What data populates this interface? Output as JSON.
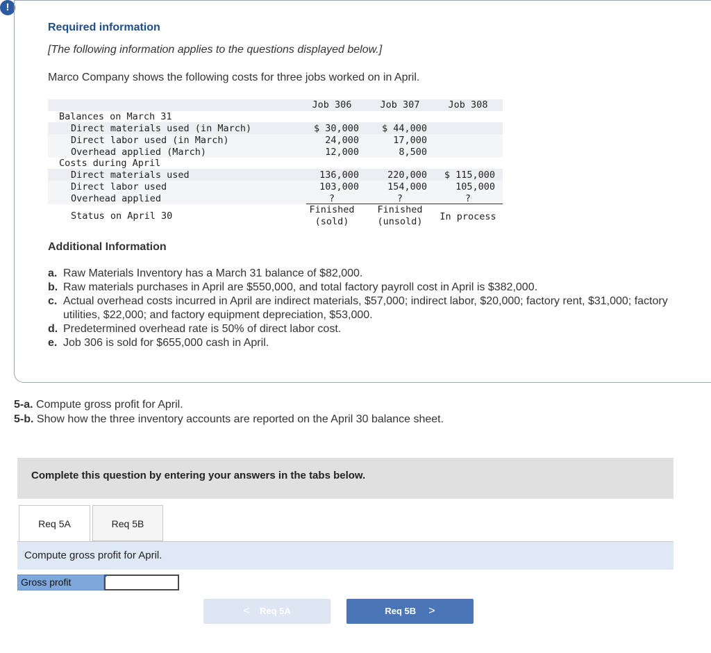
{
  "header": {
    "alert_glyph": "!",
    "title": "Required information",
    "subtitle": "[The following information applies to the questions displayed below.]",
    "intro": "Marco Company shows the following costs for three jobs worked on in April."
  },
  "cost_table": {
    "columns": [
      "Job 306",
      "Job 307",
      "Job 308"
    ],
    "section1": "Balances on March 31",
    "rows1": [
      {
        "label": "Direct materials used (in March)",
        "values": [
          "$ 30,000",
          "$ 44,000",
          ""
        ]
      },
      {
        "label": "Direct labor used (in March)",
        "values": [
          "24,000",
          "17,000",
          ""
        ]
      },
      {
        "label": "Overhead applied (March)",
        "values": [
          "12,000",
          "8,500",
          ""
        ]
      }
    ],
    "section2": "Costs during April",
    "rows2": [
      {
        "label": "Direct materials used",
        "values": [
          "136,000",
          "220,000",
          "$ 115,000"
        ]
      },
      {
        "label": "Direct labor used",
        "values": [
          "103,000",
          "154,000",
          "105,000"
        ]
      },
      {
        "label": "Overhead applied",
        "values": [
          "?",
          "?",
          "?"
        ]
      }
    ],
    "status_label": "Status on April 30",
    "status": [
      {
        "line1": "Finished",
        "line2": "(sold)"
      },
      {
        "line1": "Finished",
        "line2": "(unsold)"
      },
      {
        "line1": "In process",
        "line2": ""
      }
    ]
  },
  "additional": {
    "title": "Additional Information",
    "items": [
      {
        "letter": "a.",
        "text": "Raw Materials Inventory has a March 31 balance of $82,000."
      },
      {
        "letter": "b.",
        "text": "Raw materials purchases in April are $550,000, and total factory payroll cost in April is $382,000."
      },
      {
        "letter": "c.",
        "text": "Actual overhead costs incurred in April are indirect materials, $57,000; indirect labor, $20,000; factory rent, $31,000; factory utilities, $22,000; and factory equipment depreciation, $53,000."
      },
      {
        "letter": "d.",
        "text": "Predetermined overhead rate is 50% of direct labor cost."
      },
      {
        "letter": "e.",
        "text": "Job 306 is sold for $655,000 cash in April."
      }
    ]
  },
  "questions": [
    {
      "num": "5-a.",
      "text": "Compute gross profit for April."
    },
    {
      "num": "5-b.",
      "text": "Show how the three inventory accounts are reported on the April 30 balance sheet."
    }
  ],
  "instruction": "Complete this question by entering your answers in the tabs below.",
  "tabs": [
    "Req 5A",
    "Req 5B"
  ],
  "prompt": "Compute gross profit for April.",
  "answer": {
    "label": "Gross profit",
    "value": ""
  },
  "nav": {
    "prev_label": "Req 5A",
    "next_label": "Req 5B",
    "prev_chevron": "<",
    "next_chevron": ">"
  }
}
